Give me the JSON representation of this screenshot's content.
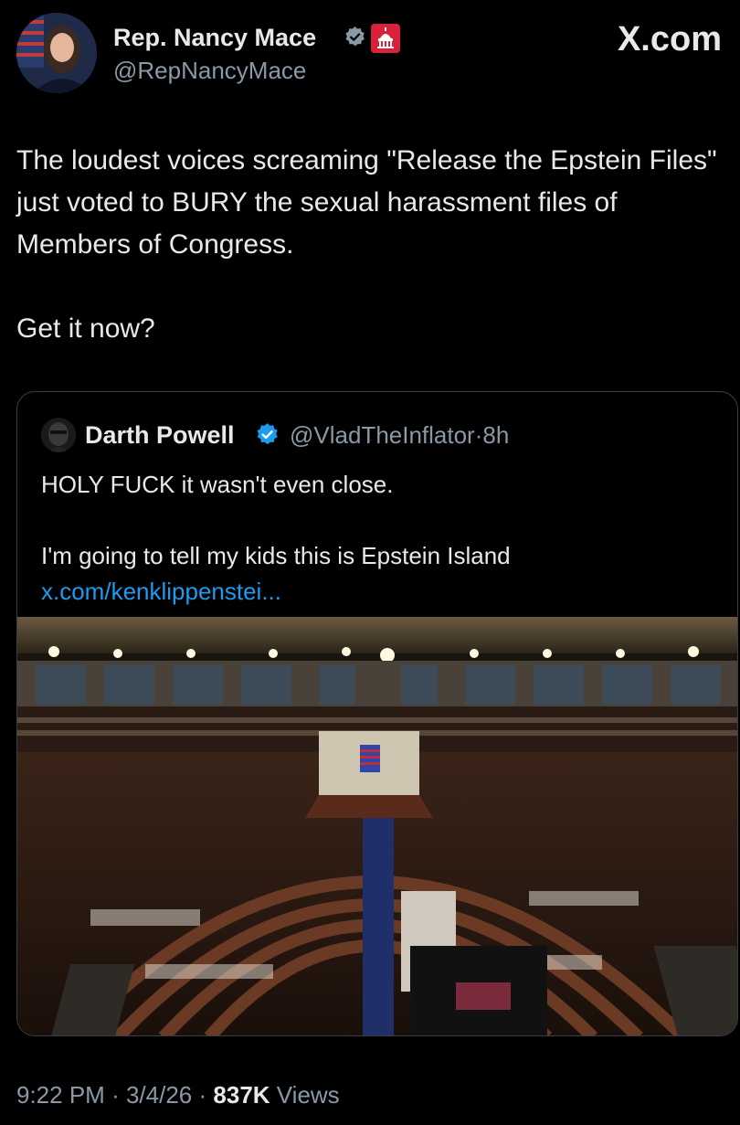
{
  "tweet": {
    "author_name": "Rep. Nancy Mace",
    "author_handle": "@RepNancyMace",
    "verified_icon": "verified-badge-icon",
    "congress_icon": "us-capitol-badge-icon",
    "brand": "X.com",
    "text_paragraphs": [
      "The loudest voices screaming \"Release the Epstein Files\" just voted to BURY the sexual harassment files of Members of Congress.",
      "Get it now?"
    ],
    "time": "9:22 PM",
    "date": "3/4/26",
    "separator": "·",
    "views_count": "837K",
    "views_label": "Views"
  },
  "quoted_tweet": {
    "author_name": "Darth Powell",
    "author_handle": "@VladTheInflator",
    "age": "8h",
    "separator": "·",
    "text_line1": "HOLY FUCK it wasn't even close.",
    "text_line2": "I'm going to tell my kids this is Epstein Island ",
    "link_text": "x.com/kenklippenstei...",
    "link_color": "#1d9bf0"
  },
  "colors": {
    "background": "#000000",
    "text": "#e7e9ea",
    "secondary_text": "#8b98a5",
    "verified_blue": "#1d9bf0",
    "congress_red": "#d8223a"
  }
}
